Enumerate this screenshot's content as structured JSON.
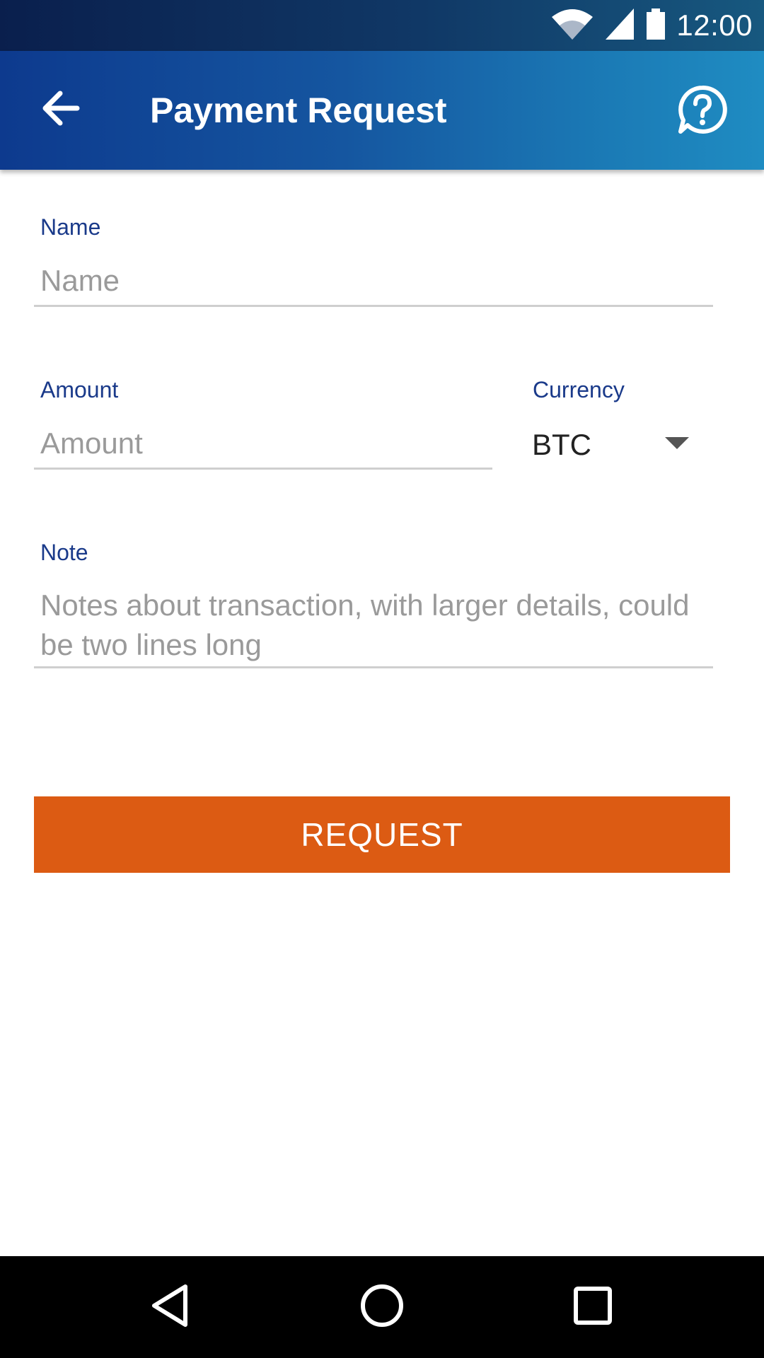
{
  "status_bar": {
    "time": "12:00",
    "icons": [
      "wifi-icon",
      "cell-signal-icon",
      "battery-icon"
    ]
  },
  "app_bar": {
    "title": "Payment Request",
    "back_icon": "arrow-back-icon",
    "help_icon": "help-icon"
  },
  "form": {
    "name": {
      "label": "Name",
      "placeholder": "Name",
      "value": ""
    },
    "amount": {
      "label": "Amount",
      "placeholder": "Amount",
      "value": ""
    },
    "currency": {
      "label": "Currency",
      "selected": "BTC"
    },
    "note": {
      "label": "Note",
      "placeholder": "Notes about transaction, with larger details, could be two lines long",
      "value": ""
    }
  },
  "actions": {
    "request_label": "REQUEST"
  },
  "nav_bar": {
    "icons": [
      "back-triangle-icon",
      "home-circle-icon",
      "recents-square-icon"
    ]
  },
  "colors": {
    "primary": "#1556a0",
    "accent": "#dc5b13",
    "label": "#1a3a8a",
    "placeholder": "#9a9a9a"
  }
}
